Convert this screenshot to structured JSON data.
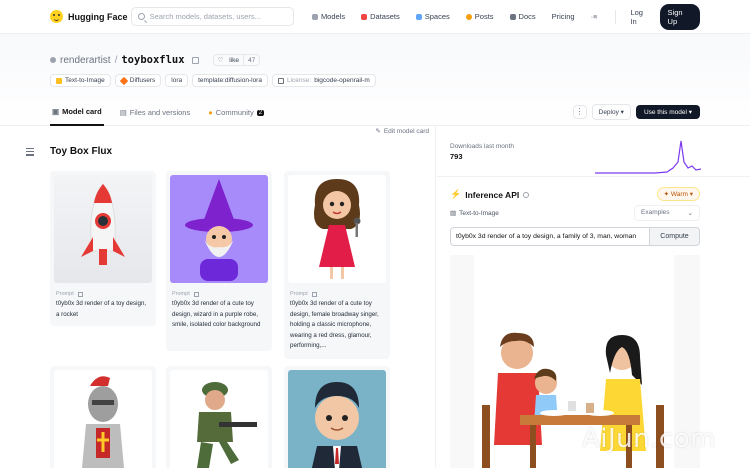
{
  "nav": {
    "brand": "Hugging Face",
    "search_placeholder": "Search models, datasets, users...",
    "links": [
      "Models",
      "Datasets",
      "Spaces",
      "Posts",
      "Docs",
      "Pricing"
    ],
    "login": "Log In",
    "signup": "Sign Up"
  },
  "repo": {
    "org": "renderartist",
    "name": "toyboxflux",
    "like_label": "like",
    "like_count": "47"
  },
  "tags": {
    "t1": "Text-to-Image",
    "t2": "Diffusers",
    "t3": "lora",
    "t4": "template:diffusion-lora",
    "license_label": "License:",
    "license": "bigcode-openrail-m"
  },
  "tabs": {
    "model_card": "Model card",
    "files": "Files and versions",
    "community": "Community",
    "community_count": "2"
  },
  "actions": {
    "kebab": "⋮",
    "deploy": "Deploy ▾",
    "use_model": "Use this model ▾"
  },
  "card": {
    "edit": "Edit model card",
    "title": "Toy Box Flux",
    "prompt_label": "Prompt",
    "prompts": [
      "t0yb0x 3d render of a toy design, a rocket",
      "t0yb0x 3d render of a cute toy design, wizard in a purple robe, smile, isolated color background",
      "t0yb0x 3d render of a cute toy design, female broadway singer, holding a classic microphone, wearing a red dress, glamour, performing,..."
    ]
  },
  "downloads": {
    "label": "Downloads last month",
    "value": "793"
  },
  "inference": {
    "title": "Inference API",
    "warm": "✦ Warm ▾",
    "task": "Text-to-Image",
    "examples": "Examples",
    "input_value": "t0yb0x 3d render of a toy design, a family of 3, man, woman",
    "compute": "Compute"
  },
  "watermark": "AiJun.com",
  "colors": {
    "accent_dark": "#111827",
    "sparkline": "#7c3aed",
    "warm": "#b45309"
  }
}
